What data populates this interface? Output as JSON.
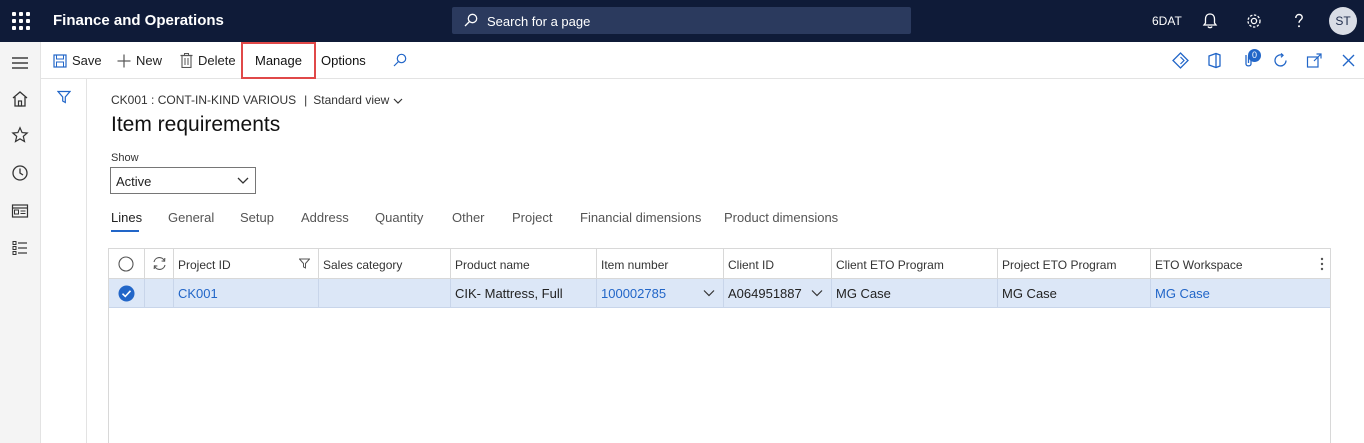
{
  "topbar": {
    "app_title": "Finance and Operations",
    "search_placeholder": "Search for a page",
    "company": "6DAT",
    "avatar_initials": "ST"
  },
  "actions": {
    "save": "Save",
    "new": "New",
    "delete": "Delete",
    "manage": "Manage",
    "options": "Options",
    "notification_count": "0"
  },
  "page": {
    "breadcrumb_record": "CK001 : CONT-IN-KIND VARIOUS",
    "breadcrumb_separator": "|",
    "view_name": "Standard view",
    "title": "Item requirements",
    "show_label": "Show",
    "show_value": "Active"
  },
  "tabs": [
    {
      "label": "Lines",
      "active": true
    },
    {
      "label": "General"
    },
    {
      "label": "Setup"
    },
    {
      "label": "Address"
    },
    {
      "label": "Quantity"
    },
    {
      "label": "Other"
    },
    {
      "label": "Project"
    },
    {
      "label": "Financial dimensions"
    },
    {
      "label": "Product dimensions"
    }
  ],
  "grid": {
    "columns": [
      "Project ID",
      "Sales category",
      "Product name",
      "Item number",
      "Client ID",
      "Client ETO Program",
      "Project ETO Program",
      "ETO Workspace"
    ],
    "rows": [
      {
        "project_id": "CK001",
        "sales_category": "",
        "product_name": "CIK- Mattress, Full",
        "item_number": "100002785",
        "client_id": "A064951887",
        "client_eto_program": "MG Case",
        "project_eto_program": "MG Case",
        "eto_workspace": "MG Case"
      }
    ]
  },
  "colors": {
    "topbar_bg": "#0f1b38",
    "accent": "#2266c8",
    "selected_row": "#dce7f7",
    "highlight_box": "#e04848"
  }
}
